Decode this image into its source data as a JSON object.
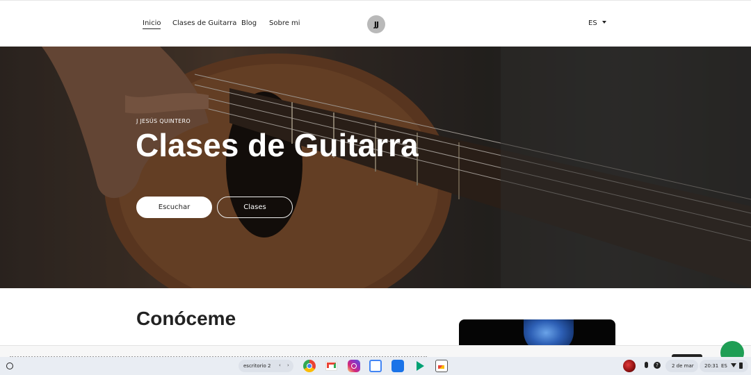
{
  "nav": {
    "links": [
      "Inicio",
      "Clases de Guitarra",
      "Blog",
      "Sobre mi"
    ],
    "logo_text": "JJ",
    "language": "ES"
  },
  "hero": {
    "eyebrow": "J JESÚS QUINTERO",
    "title": "Clases de Guitarra",
    "primary_button": "Escuchar",
    "secondary_button": "Clases"
  },
  "about": {
    "title": "Conóceme"
  },
  "shelf": {
    "desk_label": "escritorio 2",
    "desk_prev": "‹",
    "desk_next": "›",
    "apps": [
      "chrome-icon",
      "gmail-icon",
      "instagram-icon",
      "calendar-icon",
      "files-icon",
      "play-store-icon",
      "gallery-icon"
    ],
    "help": "?",
    "date": "2 de mar",
    "time": "20:31",
    "input_language": "ES"
  },
  "colors": {
    "whatsapp": "#1f9e55",
    "hero_text": "#ffffff",
    "nav_text": "#222222"
  }
}
